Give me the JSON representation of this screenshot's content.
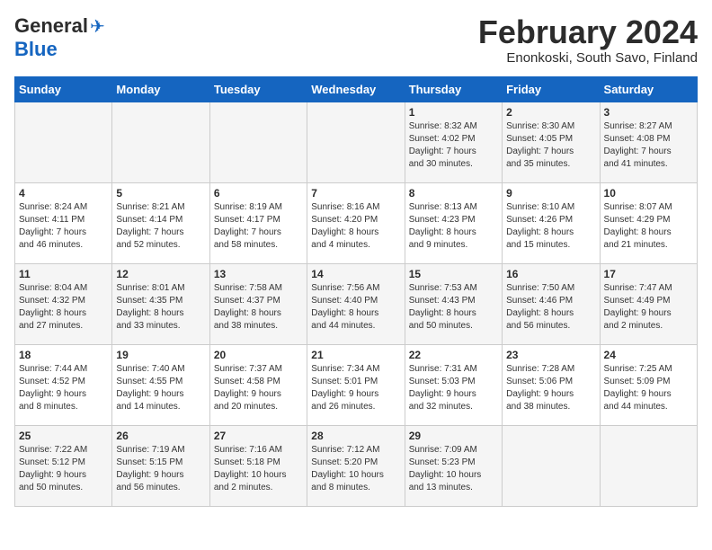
{
  "header": {
    "logo_general": "General",
    "logo_blue": "Blue",
    "month_title": "February 2024",
    "location": "Enonkoski, South Savo, Finland"
  },
  "days_of_week": [
    "Sunday",
    "Monday",
    "Tuesday",
    "Wednesday",
    "Thursday",
    "Friday",
    "Saturday"
  ],
  "weeks": [
    [
      {
        "day": "",
        "info": ""
      },
      {
        "day": "",
        "info": ""
      },
      {
        "day": "",
        "info": ""
      },
      {
        "day": "",
        "info": ""
      },
      {
        "day": "1",
        "info": "Sunrise: 8:32 AM\nSunset: 4:02 PM\nDaylight: 7 hours\nand 30 minutes."
      },
      {
        "day": "2",
        "info": "Sunrise: 8:30 AM\nSunset: 4:05 PM\nDaylight: 7 hours\nand 35 minutes."
      },
      {
        "day": "3",
        "info": "Sunrise: 8:27 AM\nSunset: 4:08 PM\nDaylight: 7 hours\nand 41 minutes."
      }
    ],
    [
      {
        "day": "4",
        "info": "Sunrise: 8:24 AM\nSunset: 4:11 PM\nDaylight: 7 hours\nand 46 minutes."
      },
      {
        "day": "5",
        "info": "Sunrise: 8:21 AM\nSunset: 4:14 PM\nDaylight: 7 hours\nand 52 minutes."
      },
      {
        "day": "6",
        "info": "Sunrise: 8:19 AM\nSunset: 4:17 PM\nDaylight: 7 hours\nand 58 minutes."
      },
      {
        "day": "7",
        "info": "Sunrise: 8:16 AM\nSunset: 4:20 PM\nDaylight: 8 hours\nand 4 minutes."
      },
      {
        "day": "8",
        "info": "Sunrise: 8:13 AM\nSunset: 4:23 PM\nDaylight: 8 hours\nand 9 minutes."
      },
      {
        "day": "9",
        "info": "Sunrise: 8:10 AM\nSunset: 4:26 PM\nDaylight: 8 hours\nand 15 minutes."
      },
      {
        "day": "10",
        "info": "Sunrise: 8:07 AM\nSunset: 4:29 PM\nDaylight: 8 hours\nand 21 minutes."
      }
    ],
    [
      {
        "day": "11",
        "info": "Sunrise: 8:04 AM\nSunset: 4:32 PM\nDaylight: 8 hours\nand 27 minutes."
      },
      {
        "day": "12",
        "info": "Sunrise: 8:01 AM\nSunset: 4:35 PM\nDaylight: 8 hours\nand 33 minutes."
      },
      {
        "day": "13",
        "info": "Sunrise: 7:58 AM\nSunset: 4:37 PM\nDaylight: 8 hours\nand 38 minutes."
      },
      {
        "day": "14",
        "info": "Sunrise: 7:56 AM\nSunset: 4:40 PM\nDaylight: 8 hours\nand 44 minutes."
      },
      {
        "day": "15",
        "info": "Sunrise: 7:53 AM\nSunset: 4:43 PM\nDaylight: 8 hours\nand 50 minutes."
      },
      {
        "day": "16",
        "info": "Sunrise: 7:50 AM\nSunset: 4:46 PM\nDaylight: 8 hours\nand 56 minutes."
      },
      {
        "day": "17",
        "info": "Sunrise: 7:47 AM\nSunset: 4:49 PM\nDaylight: 9 hours\nand 2 minutes."
      }
    ],
    [
      {
        "day": "18",
        "info": "Sunrise: 7:44 AM\nSunset: 4:52 PM\nDaylight: 9 hours\nand 8 minutes."
      },
      {
        "day": "19",
        "info": "Sunrise: 7:40 AM\nSunset: 4:55 PM\nDaylight: 9 hours\nand 14 minutes."
      },
      {
        "day": "20",
        "info": "Sunrise: 7:37 AM\nSunset: 4:58 PM\nDaylight: 9 hours\nand 20 minutes."
      },
      {
        "day": "21",
        "info": "Sunrise: 7:34 AM\nSunset: 5:01 PM\nDaylight: 9 hours\nand 26 minutes."
      },
      {
        "day": "22",
        "info": "Sunrise: 7:31 AM\nSunset: 5:03 PM\nDaylight: 9 hours\nand 32 minutes."
      },
      {
        "day": "23",
        "info": "Sunrise: 7:28 AM\nSunset: 5:06 PM\nDaylight: 9 hours\nand 38 minutes."
      },
      {
        "day": "24",
        "info": "Sunrise: 7:25 AM\nSunset: 5:09 PM\nDaylight: 9 hours\nand 44 minutes."
      }
    ],
    [
      {
        "day": "25",
        "info": "Sunrise: 7:22 AM\nSunset: 5:12 PM\nDaylight: 9 hours\nand 50 minutes."
      },
      {
        "day": "26",
        "info": "Sunrise: 7:19 AM\nSunset: 5:15 PM\nDaylight: 9 hours\nand 56 minutes."
      },
      {
        "day": "27",
        "info": "Sunrise: 7:16 AM\nSunset: 5:18 PM\nDaylight: 10 hours\nand 2 minutes."
      },
      {
        "day": "28",
        "info": "Sunrise: 7:12 AM\nSunset: 5:20 PM\nDaylight: 10 hours\nand 8 minutes."
      },
      {
        "day": "29",
        "info": "Sunrise: 7:09 AM\nSunset: 5:23 PM\nDaylight: 10 hours\nand 13 minutes."
      },
      {
        "day": "",
        "info": ""
      },
      {
        "day": "",
        "info": ""
      }
    ]
  ]
}
